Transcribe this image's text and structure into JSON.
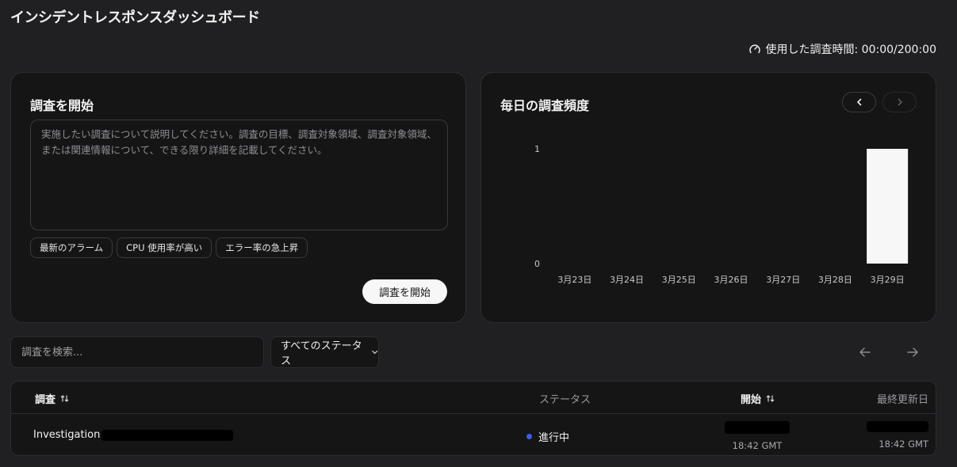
{
  "header": {
    "title": "インシデントレスポンスダッシュボード",
    "usage_label": "使用した調査時間: 00:00/200:00"
  },
  "start_card": {
    "title": "調査を開始",
    "placeholder": "実施したい調査について説明してください。調査の目標、調査対象領域、調査対象領域、または関連情報について、できる限り詳細を記載してください。",
    "chips": [
      "最新のアラーム",
      "CPU 使用率が高い",
      "エラー率の急上昇"
    ],
    "button_label": "調査を開始"
  },
  "chart_card": {
    "title": "毎日の調査頻度"
  },
  "chart_data": {
    "type": "bar",
    "categories": [
      "3月23日",
      "3月24日",
      "3月25日",
      "3月26日",
      "3月27日",
      "3月28日",
      "3月29日"
    ],
    "values": [
      0,
      0,
      0,
      0,
      0,
      0,
      1
    ],
    "title": "毎日の調査頻度",
    "ylim": [
      0,
      1
    ],
    "yticks": [
      "0",
      "1"
    ],
    "grid": false,
    "bar_color": "#f7f7f7"
  },
  "filters": {
    "search_placeholder": "調査を検索...",
    "status_select": "すべてのステータス"
  },
  "table": {
    "columns": {
      "name": "調査",
      "status": "ステータス",
      "start": "開始",
      "updated": "最終更新日"
    },
    "rows": [
      {
        "name": "Investigation",
        "status": "進行中",
        "status_color": "#3a5bf0",
        "start_time": "18:42 GMT",
        "updated_time": "18:42 GMT"
      }
    ]
  },
  "icons": {
    "usage": "gauge-icon",
    "prev": "chevron-left-icon",
    "next": "chevron-right-icon",
    "sort": "sort-icon",
    "dropdown": "chevron-down-icon"
  }
}
